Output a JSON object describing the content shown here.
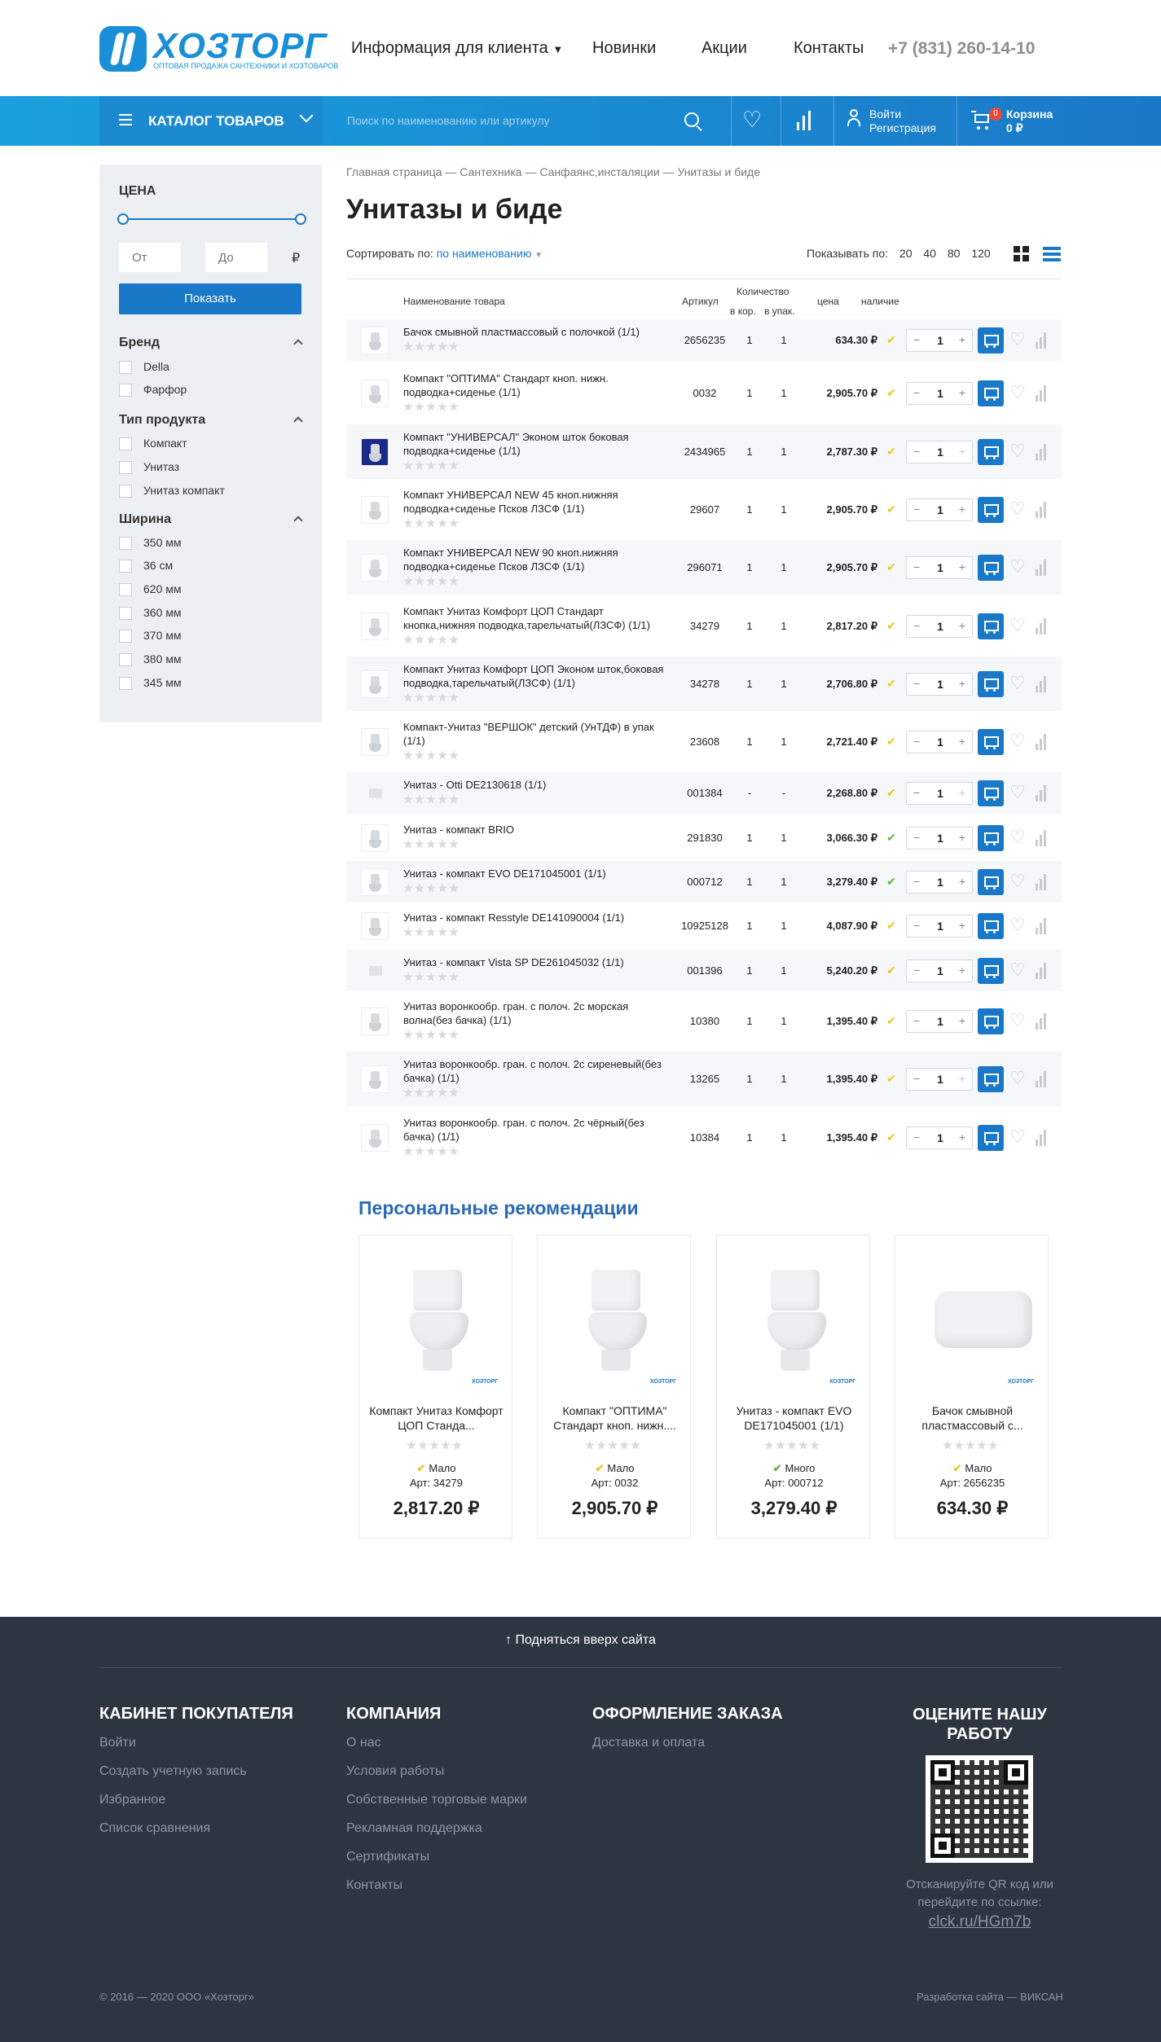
{
  "header": {
    "logo_name": "ХОЗТОРГ",
    "logo_tagline": "ОПТОВАЯ ПРОДАЖА САНТЕХНИКИ И ХОЗТОВАРОВ",
    "nav": [
      {
        "label": "Информация для клиента"
      },
      {
        "label": "Новинки"
      },
      {
        "label": "Акции"
      },
      {
        "label": "Контакты"
      }
    ],
    "phone": "+7 (831) 260-14-10"
  },
  "bar": {
    "catalog_label": "КАТАЛОГ ТОВАРОВ",
    "search_placeholder": "Поиск по наименованию или артикулу",
    "login": "Войти",
    "register": "Регистрация",
    "cart_label": "Корзина",
    "cart_sum": "0 ₽",
    "cart_count": "0"
  },
  "filters": {
    "price_title": "ЦЕНА",
    "from_placeholder": "От",
    "to_placeholder": "До",
    "currency": "₽",
    "show_button": "Показать",
    "groups": [
      {
        "title": "Бренд",
        "items": [
          "Della",
          "Фарфор"
        ]
      },
      {
        "title": "Тип продукта",
        "items": [
          "Компакт",
          "Унитаз",
          "Унитаз компакт"
        ]
      },
      {
        "title": "Ширина",
        "items": [
          "350 мм",
          "36 см",
          "620 мм",
          "360 мм",
          "370 мм",
          "380 мм",
          "345 мм"
        ]
      }
    ]
  },
  "breadcrumbs": "Главная страница — Сантехника — Санфаянс,инсталяции — Унитазы и биде",
  "page_title": "Унитазы и биде",
  "sort": {
    "label": "Сортировать по:",
    "value": "по наименованию"
  },
  "showby": {
    "label": "Показывать по:",
    "options": "20 40 80 120"
  },
  "table_header": {
    "name": "Наименование товара",
    "article": "Артикул",
    "qty": "Количество",
    "qty_box": "в кор.",
    "qty_pack": "в упак.",
    "price": "цена",
    "avail": "наличие"
  },
  "products": [
    {
      "name": "Бачок смывной пластмассовый с полочкой (1/1)",
      "article": "2656235",
      "box": "1",
      "pack": "1",
      "price": "634.30 ₽",
      "qty": "1"
    },
    {
      "name": "Компакт \"ОПТИМА\" Стандарт кноп. нижн. подводка+сиденье (1/1)",
      "article": "0032",
      "box": "1",
      "pack": "1",
      "price": "2,905.70 ₽",
      "qty": "1"
    },
    {
      "name": "Компакт \"УНИВЕРСАЛ\" Эконом шток боковая подводка+сиденье (1/1)",
      "article": "2434965",
      "box": "1",
      "pack": "1",
      "price": "2,787.30 ₽",
      "qty": "1"
    },
    {
      "name": "Компакт УНИВЕРСАЛ NEW 45 кноп.нижняя подводка+сиденье Псков ЛЗСФ (1/1)",
      "article": "29607",
      "box": "1",
      "pack": "1",
      "price": "2,905.70 ₽",
      "qty": "1"
    },
    {
      "name": "Компакт УНИВЕРСАЛ NEW 90 кноп.нижняя подводка+сиденье Псков ЛЗСФ (1/1)",
      "article": "296071",
      "box": "1",
      "pack": "1",
      "price": "2,905.70 ₽",
      "qty": "1"
    },
    {
      "name": "Компакт Унитаз Комфорт ЦОП Стандарт кнопка,нижняя подводка,тарельчатый(ЛЗСФ) (1/1)",
      "article": "34279",
      "box": "1",
      "pack": "1",
      "price": "2,817.20 ₽",
      "qty": "1"
    },
    {
      "name": "Компакт Унитаз Комфорт ЦОП Эконом шток,боковая подводка,тарельчатый(ЛЗСФ) (1/1)",
      "article": "34278",
      "box": "1",
      "pack": "1",
      "price": "2,706.80 ₽",
      "qty": "1"
    },
    {
      "name": "Компакт-Унитаз \"ВЕРШОК\" детский (УнТДФ) в упак (1/1)",
      "article": "23608",
      "box": "1",
      "pack": "1",
      "price": "2,721.40 ₽",
      "qty": "1"
    },
    {
      "name": "Унитаз - Otti DE2130618 (1/1)",
      "article": "001384",
      "box": "-",
      "pack": "-",
      "price": "2,268.80 ₽",
      "qty": "1"
    },
    {
      "name": "Унитаз - компакт BRIO",
      "article": "291830",
      "box": "1",
      "pack": "1",
      "price": "3,066.30 ₽",
      "qty": "1"
    },
    {
      "name": "Унитаз - компакт EVO DE171045001 (1/1)",
      "article": "000712",
      "box": "1",
      "pack": "1",
      "price": "3,279.40 ₽",
      "qty": "1"
    },
    {
      "name": "Унитаз - компакт Resstyle DE141090004 (1/1)",
      "article": "10925128",
      "box": "1",
      "pack": "1",
      "price": "4,087.90 ₽",
      "qty": "1"
    },
    {
      "name": "Унитаз - компакт Vista SP DE261045032 (1/1)",
      "article": "001396",
      "box": "1",
      "pack": "1",
      "price": "5,240.20 ₽",
      "qty": "1"
    },
    {
      "name": "Унитаз воронкообр. гран. с полоч. 2с морская волна(без бачка) (1/1)",
      "article": "10380",
      "box": "1",
      "pack": "1",
      "price": "1,395.40 ₽",
      "qty": "1"
    },
    {
      "name": "Унитаз воронкообр. гран. с полоч. 2с сиреневый(без бачка) (1/1)",
      "article": "13265",
      "box": "1",
      "pack": "1",
      "price": "1,395.40 ₽",
      "qty": "1"
    },
    {
      "name": "Унитаз воронкообр. гран. с полоч. 2с чёрный(без бачка) (1/1)",
      "article": "10384",
      "box": "1",
      "pack": "1",
      "price": "1,395.40 ₽",
      "qty": "1"
    }
  ],
  "recommendations": {
    "title": "Персональные рекомендации",
    "brand_mark": "ХОЗТОРГ",
    "items": [
      {
        "name": "Компакт Унитаз Комфорт ЦОП Станда...",
        "stock": "Мало",
        "article": "Арт: 34279",
        "price": "2,817.20 ₽"
      },
      {
        "name": "Компакт \"ОПТИМА\" Стандарт кноп. нижн....",
        "stock": "Мало",
        "article": "Арт: 0032",
        "price": "2,905.70 ₽"
      },
      {
        "name": "Унитаз - компакт EVO DE171045001 (1/1)",
        "stock": "Много",
        "article": "Арт: 000712",
        "price": "3,279.40 ₽"
      },
      {
        "name": "Бачок смывной пластмассовый с...",
        "stock": "Мало",
        "article": "Арт: 2656235",
        "price": "634.30 ₽"
      }
    ]
  },
  "footer": {
    "scroll_up": "↑ Подняться вверх сайта",
    "cols": [
      {
        "title": "КАБИНЕТ ПОКУПАТЕЛЯ",
        "links": [
          "Войти",
          "Создать учетную запись",
          "Избранное",
          "Список сравнения"
        ]
      },
      {
        "title": "КОМПАНИЯ",
        "links": [
          "О нас",
          "Условия работы",
          "Собственные торговые марки",
          "Рекламная поддержка",
          "Сертификаты",
          "Контакты"
        ]
      },
      {
        "title": "ОФОРМЛЕНИЕ ЗАКАЗА",
        "links": [
          "Доставка и оплата"
        ]
      }
    ],
    "rate_title": "ОЦЕНИТЕ НАШУ РАБОТУ",
    "qr_text": "Отсканируйте QR код или перейдите по ссылке:",
    "qr_link": "clck.ru/HGm7b",
    "copyright": "© 2016 — 2020 ООО «Хозторг»",
    "developer": "Разработка сайта — ВИКСАН"
  }
}
